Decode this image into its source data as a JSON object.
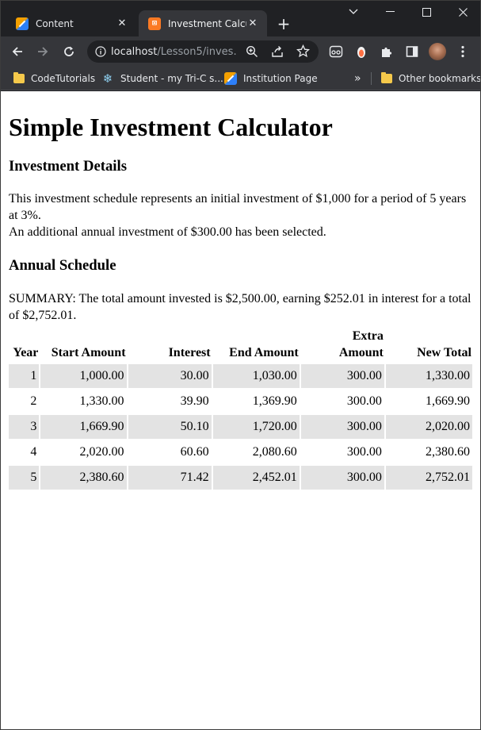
{
  "browser": {
    "tabs": [
      {
        "title": "Content",
        "active": false,
        "favicon": "pencil-icon"
      },
      {
        "title": "Investment Calcula",
        "active": true,
        "favicon": "xampp-icon"
      }
    ],
    "new_tab": "+",
    "window_controls": {
      "tab_search": "⌄",
      "minimize": "—",
      "maximize": "☐",
      "close": "✕"
    },
    "address": {
      "host": "localhost",
      "path": "/Lesson5/inves..."
    },
    "bookmarks": [
      {
        "label": "CodeTutorials",
        "icon": "folder-icon"
      },
      {
        "label": "Student - my Tri-C s...",
        "icon": "snowflake-icon"
      },
      {
        "label": "Institution Page",
        "icon": "pencil-icon"
      }
    ],
    "bookmarks_overflow": "»",
    "other_bookmarks": "Other bookmarks"
  },
  "page": {
    "title": "Simple Investment Calculator",
    "details_heading": "Investment Details",
    "details_line1": "This investment schedule represents an initial investment of $1,000 for a period of 5 years at 3%.",
    "details_line2": "An additional annual investment of $300.00 has been selected.",
    "schedule_heading": "Annual Schedule",
    "summary": "SUMMARY: The total amount invested is $2,500.00, earning $252.01 in interest for a total of $2,752.01.",
    "table": {
      "headers": [
        "Year",
        "Start Amount",
        "Interest",
        "End Amount",
        "Extra Amount",
        "New Total"
      ],
      "rows": [
        [
          "1",
          "1,000.00",
          "30.00",
          "1,030.00",
          "300.00",
          "1,330.00"
        ],
        [
          "2",
          "1,330.00",
          "39.90",
          "1,369.90",
          "300.00",
          "1,669.90"
        ],
        [
          "3",
          "1,669.90",
          "50.10",
          "1,720.00",
          "300.00",
          "2,020.00"
        ],
        [
          "4",
          "2,020.00",
          "60.60",
          "2,080.60",
          "300.00",
          "2,380.60"
        ],
        [
          "5",
          "2,380.60",
          "71.42",
          "2,452.01",
          "300.00",
          "2,752.01"
        ]
      ]
    }
  }
}
